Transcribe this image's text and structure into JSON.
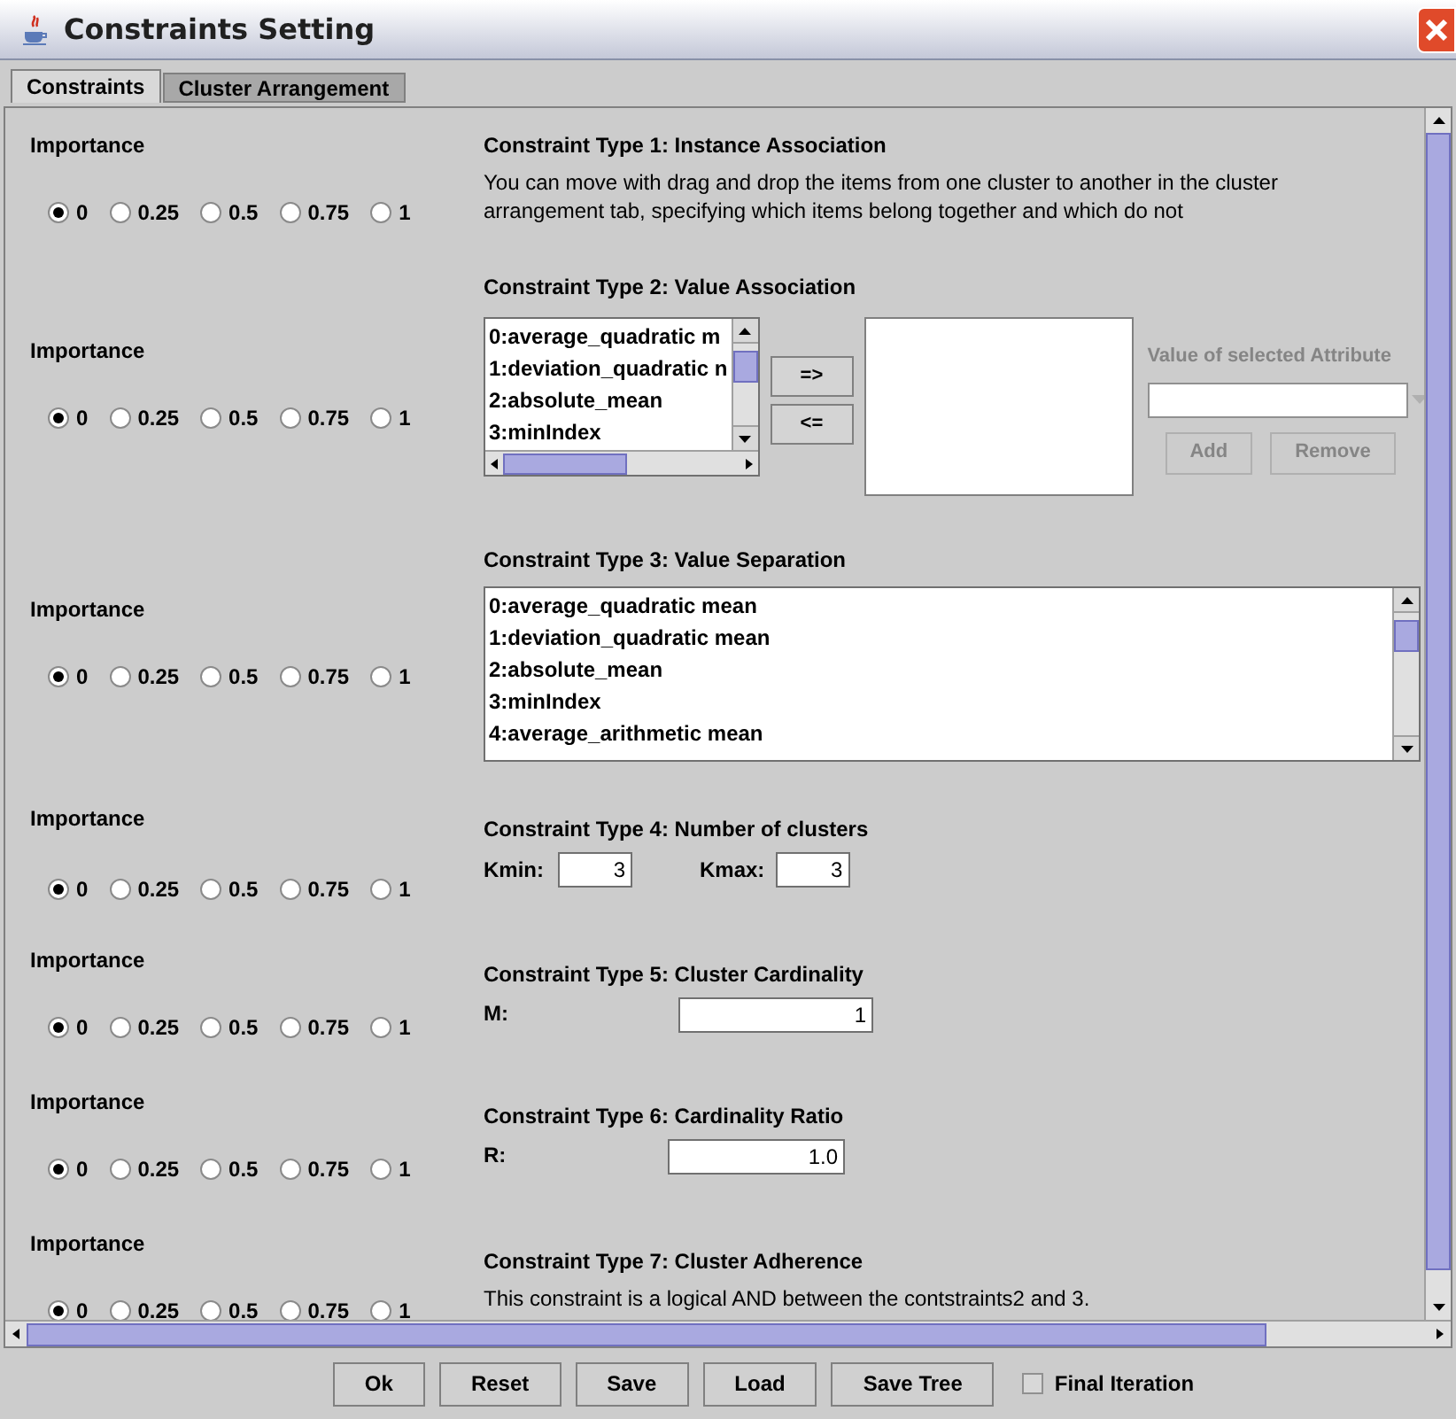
{
  "window": {
    "title": "Constraints Setting"
  },
  "tabs": [
    {
      "label": "Constraints",
      "selected": true
    },
    {
      "label": "Cluster Arrangement",
      "selected": false
    }
  ],
  "sections": [
    {
      "kind": "text",
      "importance_label": "Importance",
      "options": [
        {
          "label": "0",
          "selected": true
        },
        {
          "label": "0.25",
          "selected": false
        },
        {
          "label": "0.5",
          "selected": false
        },
        {
          "label": "0.75",
          "selected": false
        },
        {
          "label": "1",
          "selected": false
        }
      ],
      "title": "Constraint Type 1: Instance Association",
      "description": "You can move with drag and drop the items from one cluster to another in the cluster arrangement tab, specifying which items belong together and which do not"
    },
    {
      "kind": "value_association",
      "importance_label": "Importance",
      "options": [
        {
          "label": "0",
          "selected": true
        },
        {
          "label": "0.25",
          "selected": false
        },
        {
          "label": "0.5",
          "selected": false
        },
        {
          "label": "0.75",
          "selected": false
        },
        {
          "label": "1",
          "selected": false
        }
      ],
      "title": "Constraint Type 2: Value Association",
      "items": [
        "0:average_quadratic m",
        "1:deviation_quadratic n",
        "2:absolute_mean",
        "3:minIndex"
      ],
      "add_arrow": "=>",
      "remove_arrow": "<=",
      "attribute_label": "Value of selected Attribute",
      "attribute_buttons": [
        {
          "label": "Add",
          "disabled": true
        },
        {
          "label": "Remove",
          "disabled": true
        }
      ]
    },
    {
      "kind": "list",
      "importance_label": "Importance",
      "options": [
        {
          "label": "0",
          "selected": true
        },
        {
          "label": "0.25",
          "selected": false
        },
        {
          "label": "0.5",
          "selected": false
        },
        {
          "label": "0.75",
          "selected": false
        },
        {
          "label": "1",
          "selected": false
        }
      ],
      "title": "Constraint Type 3: Value Separation",
      "items": [
        "0:average_quadratic mean",
        "1:deviation_quadratic mean",
        "2:absolute_mean",
        "3:minIndex",
        "4:average_arithmetic mean"
      ]
    },
    {
      "kind": "range",
      "importance_label": "Importance",
      "options": [
        {
          "label": "0",
          "selected": true
        },
        {
          "label": "0.25",
          "selected": false
        },
        {
          "label": "0.5",
          "selected": false
        },
        {
          "label": "0.75",
          "selected": false
        },
        {
          "label": "1",
          "selected": false
        }
      ],
      "title": "Constraint Type 4: Number of clusters",
      "fields": [
        {
          "label": "Kmin:",
          "value": "3"
        },
        {
          "label": "Kmax:",
          "value": "3"
        }
      ]
    },
    {
      "kind": "field",
      "importance_label": "Importance",
      "options": [
        {
          "label": "0",
          "selected": true
        },
        {
          "label": "0.25",
          "selected": false
        },
        {
          "label": "0.5",
          "selected": false
        },
        {
          "label": "0.75",
          "selected": false
        },
        {
          "label": "1",
          "selected": false
        }
      ],
      "title": "Constraint Type 5: Cluster Cardinality",
      "field": {
        "label": "M:",
        "value": "1"
      }
    },
    {
      "kind": "field",
      "importance_label": "Importance",
      "options": [
        {
          "label": "0",
          "selected": true
        },
        {
          "label": "0.25",
          "selected": false
        },
        {
          "label": "0.5",
          "selected": false
        },
        {
          "label": "0.75",
          "selected": false
        },
        {
          "label": "1",
          "selected": false
        }
      ],
      "title": "Constraint Type 6: Cardinality Ratio",
      "field": {
        "label": "R:",
        "value": "1.0"
      }
    },
    {
      "kind": "text",
      "importance_label": "Importance",
      "options": [
        {
          "label": "0",
          "selected": true
        },
        {
          "label": "0.25",
          "selected": false
        },
        {
          "label": "0.5",
          "selected": false
        },
        {
          "label": "0.75",
          "selected": false
        },
        {
          "label": "1",
          "selected": false
        }
      ],
      "title": "Constraint Type 7: Cluster Adherence",
      "description": "This constraint is a logical AND between the contstraints2 and 3."
    }
  ],
  "buttons": [
    {
      "label": "Ok"
    },
    {
      "label": "Reset"
    },
    {
      "label": "Save"
    },
    {
      "label": "Load"
    },
    {
      "label": "Save Tree"
    }
  ],
  "final_iteration": {
    "label": "Final Iteration",
    "checked": false
  }
}
